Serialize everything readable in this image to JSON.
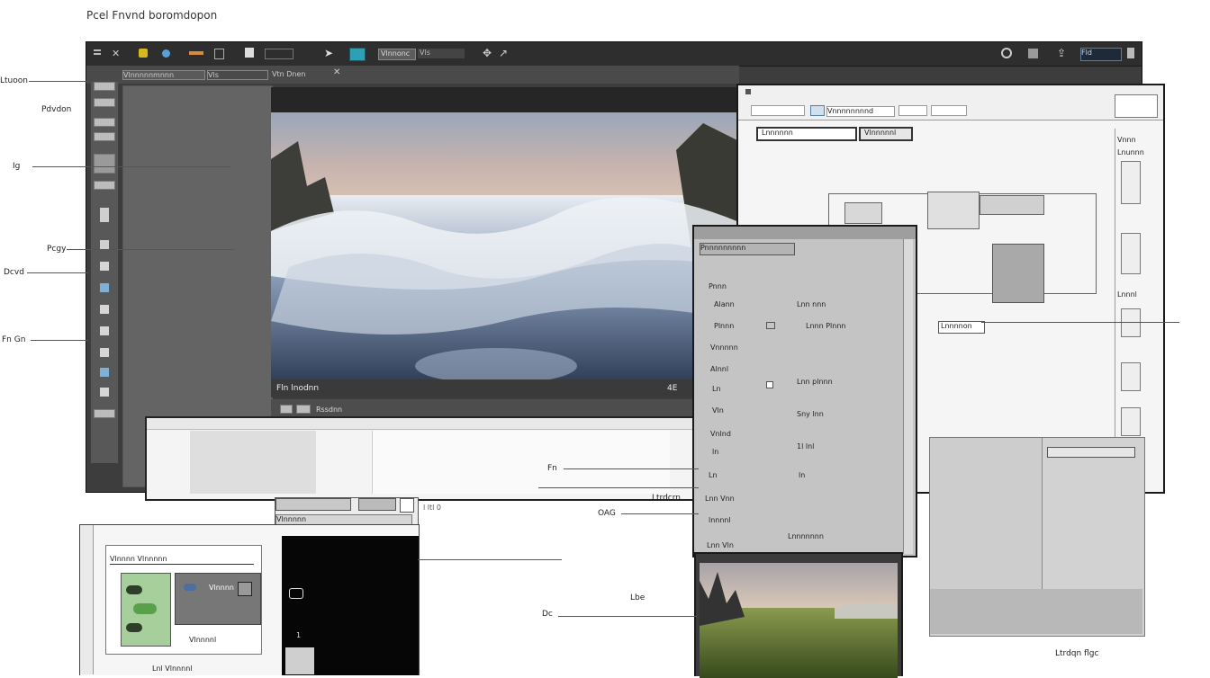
{
  "page": {
    "caption": "Pcel Fnvnd boromdopon"
  },
  "callouts": [
    "Ltuoon",
    "Pdvdon",
    "Ig",
    "Pcgy",
    "Dcvd",
    "Fn Gn",
    "Fn",
    "Ltrdcrn",
    "OAG",
    "Lbe",
    "Dc",
    "Ltrdqn flgc"
  ],
  "main_app": {
    "toolbar": {
      "mode_label": "Vlnnonc",
      "mode_value": "Vls",
      "right_values": [
        "Fld"
      ]
    },
    "menu": [
      "Vlnnnnnmnnn",
      "Vls",
      "Vtn Dnen"
    ],
    "viewer": {
      "caption": "Fln lnodnn",
      "time": "4E"
    },
    "timeline": {
      "label": "Rssdnn"
    }
  },
  "doc_window": {
    "toolbar_field": "Vnnnnnnnnd",
    "tabs": [
      "Lnnnnnn",
      "Vlnnnnnl"
    ],
    "side_labels": [
      "Vnnn",
      "Lnunnn",
      "Lnnnl"
    ],
    "button": "Lnnnnon"
  },
  "properties_panel": {
    "header": "Pnnnnnnnnn",
    "rows": [
      {
        "label": "Pnnn",
        "value": ""
      },
      {
        "label": "Alann",
        "value": "Lnn nnn"
      },
      {
        "label": "Plnnn",
        "value": "Lnnn Plnnn"
      },
      {
        "label": "Vnnnnn",
        "value": ""
      },
      {
        "label": "Alnnl",
        "value": ""
      },
      {
        "label": "Ln",
        "value": "Lnn plnnn"
      },
      {
        "label": "Vln",
        "value": "Sny lnn"
      },
      {
        "label": "Vnlnd",
        "value": ""
      },
      {
        "label": "ln",
        "value": "1l lnl"
      },
      {
        "label": "Ln",
        "value": "ln"
      },
      {
        "label": "Lnn Vnn",
        "value": ""
      },
      {
        "label": "lnnnnl",
        "value": ""
      },
      {
        "label": "Lnn Vln",
        "value": "Lnnnnnnn"
      }
    ]
  },
  "small_window": {
    "tab": "Vlnnnnn",
    "label": "l ltl 0"
  },
  "bottom_panel": {
    "status": "Lnl Vlnnnnl",
    "counter": "1"
  },
  "mini_window": {
    "header": "Vlnnnn Vlnnnnn",
    "items": [
      "Vlnnnn",
      "Vlnnnnl"
    ]
  },
  "colors": {
    "app_frame": "#3d3d3d",
    "panel_gray": "#646464",
    "light_panel": "#c4c4c4",
    "window_bg": "#f2f2f2"
  }
}
